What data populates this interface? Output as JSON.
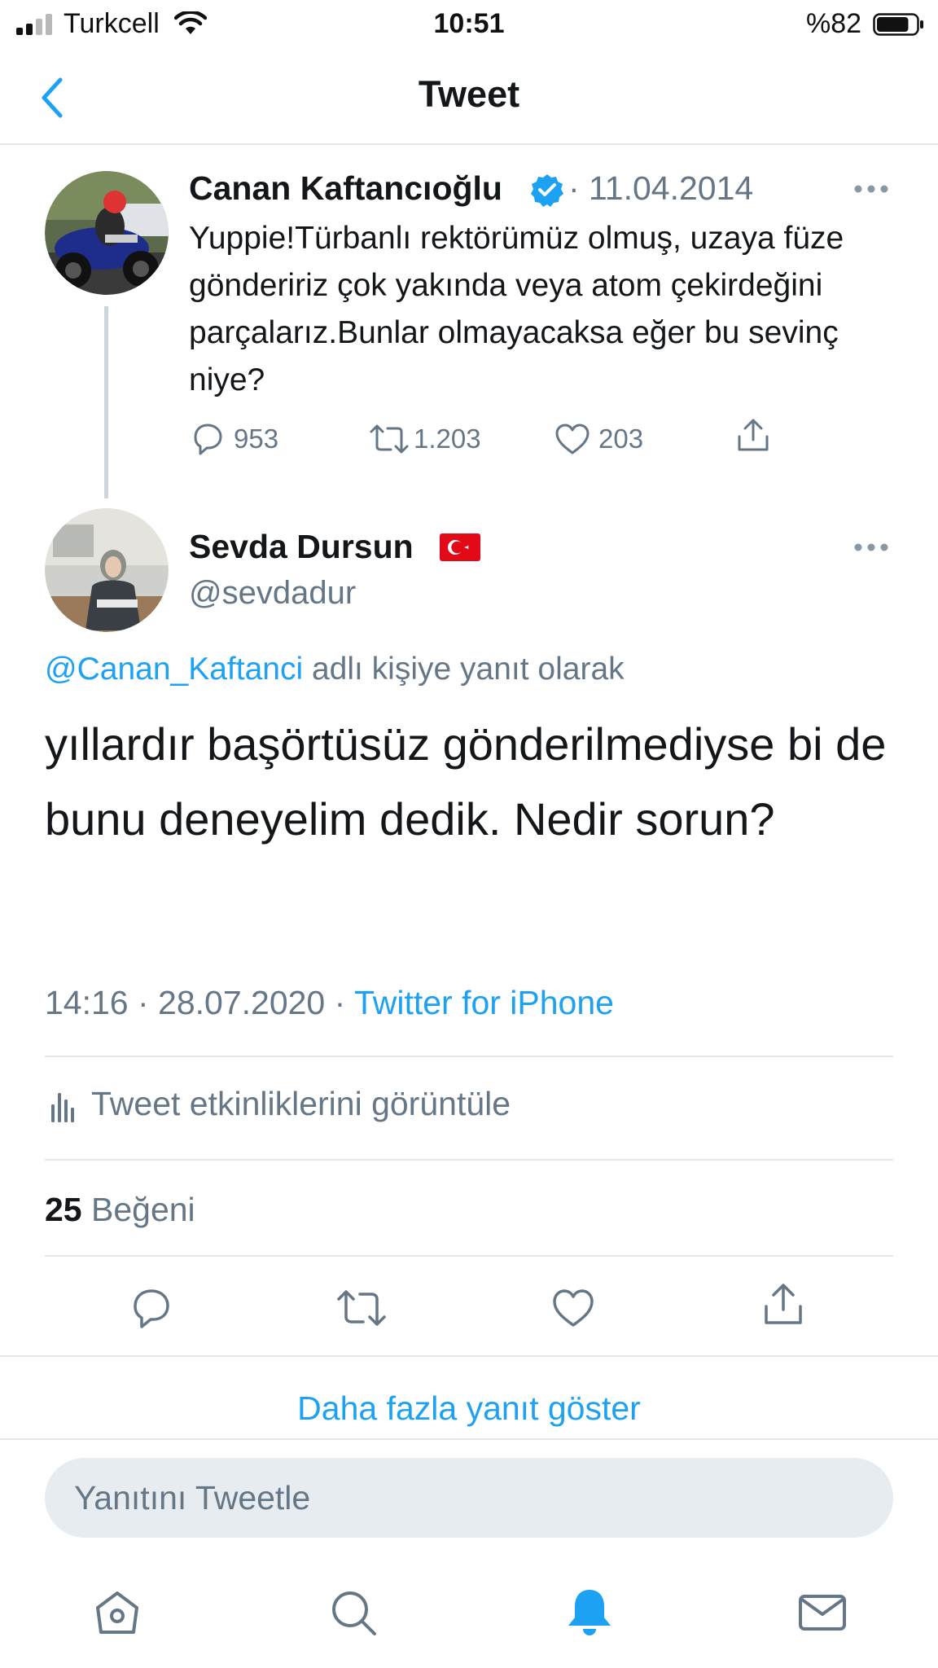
{
  "status_bar": {
    "carrier": "Turkcell",
    "time": "10:51",
    "battery_percent": "%82",
    "battery_level": 0.82
  },
  "header": {
    "title": "Tweet",
    "back_icon": "chevron-left-icon"
  },
  "parent_tweet": {
    "name": "Canan Kaftancıoğlu",
    "verified": true,
    "date": "· 11.04.2014",
    "text": "Yuppie!Türbanlı rektörümüz olmuş, uzaya füze göndeririz çok yakında veya atom çekirdeğini parçalarız.Bunlar olmayacaksa eğer bu sevinç niye?",
    "replies": "953",
    "retweets": "1.203",
    "likes": "203"
  },
  "main_tweet": {
    "name": "Sevda Dursun",
    "handle": "@sevdadur",
    "reply_to_mention": "@Canan_Kaftanci",
    "reply_to_suffix": " adlı kişiye yanıt olarak",
    "text": "yıllardır başörtüsüz gönderilmediyse bi de bunu deneyelim dedik. Nedir sorun?",
    "meta_time": "14:16 · 28.07.2020 · ",
    "meta_source": "Twitter for iPhone",
    "analytics_label": "Tweet etkinliklerini görüntüle",
    "likes_count": "25",
    "likes_label": " Beğeni"
  },
  "more_replies": "Daha fazla yanıt göster",
  "reply_placeholder": "Yanıtını Tweetle",
  "tab_bar": [
    "home-icon",
    "search-icon",
    "notifications-icon",
    "messages-icon"
  ],
  "colors": {
    "accent": "#1da1f2",
    "secondary_text": "#657786",
    "divider": "#e1e8ed",
    "reply_box": "#e6ecf0",
    "flag_red": "#e30a17"
  }
}
